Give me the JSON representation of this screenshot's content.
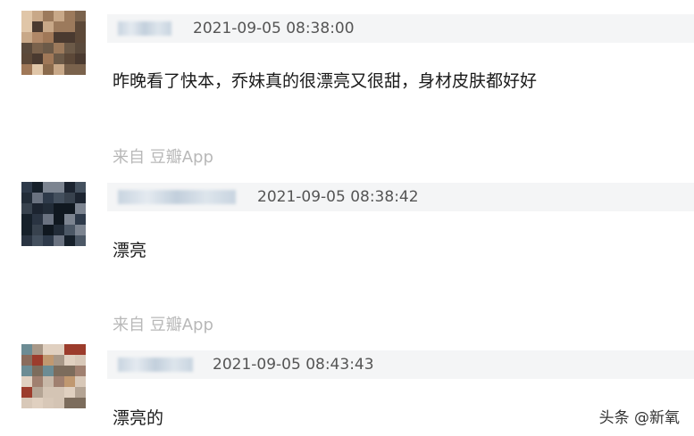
{
  "comments": [
    {
      "timestamp": "2021-09-05 08:38:00",
      "text": "昨晚看了快本，乔妹真的很漂亮又很甜，身材皮肤都好好",
      "source": "来自 豆瓣App"
    },
    {
      "timestamp": "2021-09-05 08:38:42",
      "text": "漂亮",
      "source": "来自 豆瓣App"
    },
    {
      "timestamp": "2021-09-05 08:43:43",
      "text": "漂亮的"
    }
  ],
  "watermark": "头条 @新氧"
}
